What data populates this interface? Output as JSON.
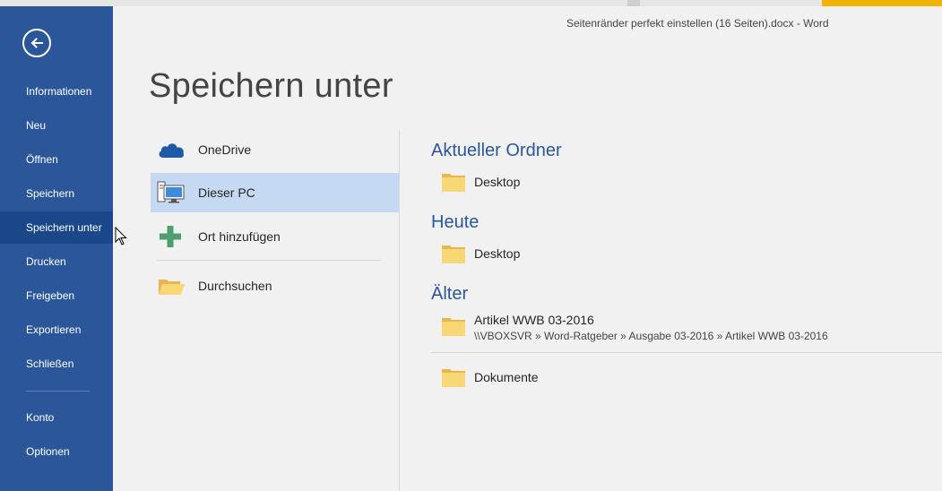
{
  "window": {
    "title": "Seitenränder perfekt einstellen (16 Seiten).docx - Word"
  },
  "sidebar": {
    "back_icon": "back-arrow-icon",
    "items": [
      {
        "label": "Informationen"
      },
      {
        "label": "Neu"
      },
      {
        "label": "Öffnen"
      },
      {
        "label": "Speichern"
      },
      {
        "label": "Speichern unter",
        "selected": true
      },
      {
        "label": "Drucken"
      },
      {
        "label": "Freigeben"
      },
      {
        "label": "Exportieren"
      },
      {
        "label": "Schließen"
      },
      {
        "label": "Konto"
      },
      {
        "label": "Optionen"
      }
    ]
  },
  "main": {
    "title": "Speichern unter",
    "places": [
      {
        "label": "OneDrive",
        "icon": "onedrive-cloud-icon"
      },
      {
        "label": "Dieser PC",
        "icon": "computer-icon",
        "selected": true
      },
      {
        "label": "Ort hinzufügen",
        "icon": "plus-icon"
      },
      {
        "label": "Durchsuchen",
        "icon": "open-folder-icon"
      }
    ],
    "sections": {
      "current": {
        "heading": "Aktueller Ordner",
        "folders": [
          {
            "name": "Desktop"
          }
        ]
      },
      "today": {
        "heading": "Heute",
        "folders": [
          {
            "name": "Desktop"
          }
        ]
      },
      "older": {
        "heading": "Älter",
        "folders": [
          {
            "name": "Artikel WWB 03-2016",
            "path": "\\\\VBOXSVR » Word-Ratgeber » Ausgabe 03-2016 » Artikel WWB 03-2016"
          },
          {
            "name": "Dokumente"
          }
        ]
      }
    }
  },
  "colors": {
    "sidebar": "#2b579a",
    "sidebar_selected": "#19478a",
    "place_selected": "#c5d9f2",
    "heading": "#2b579a",
    "folder": "#f8d775"
  }
}
